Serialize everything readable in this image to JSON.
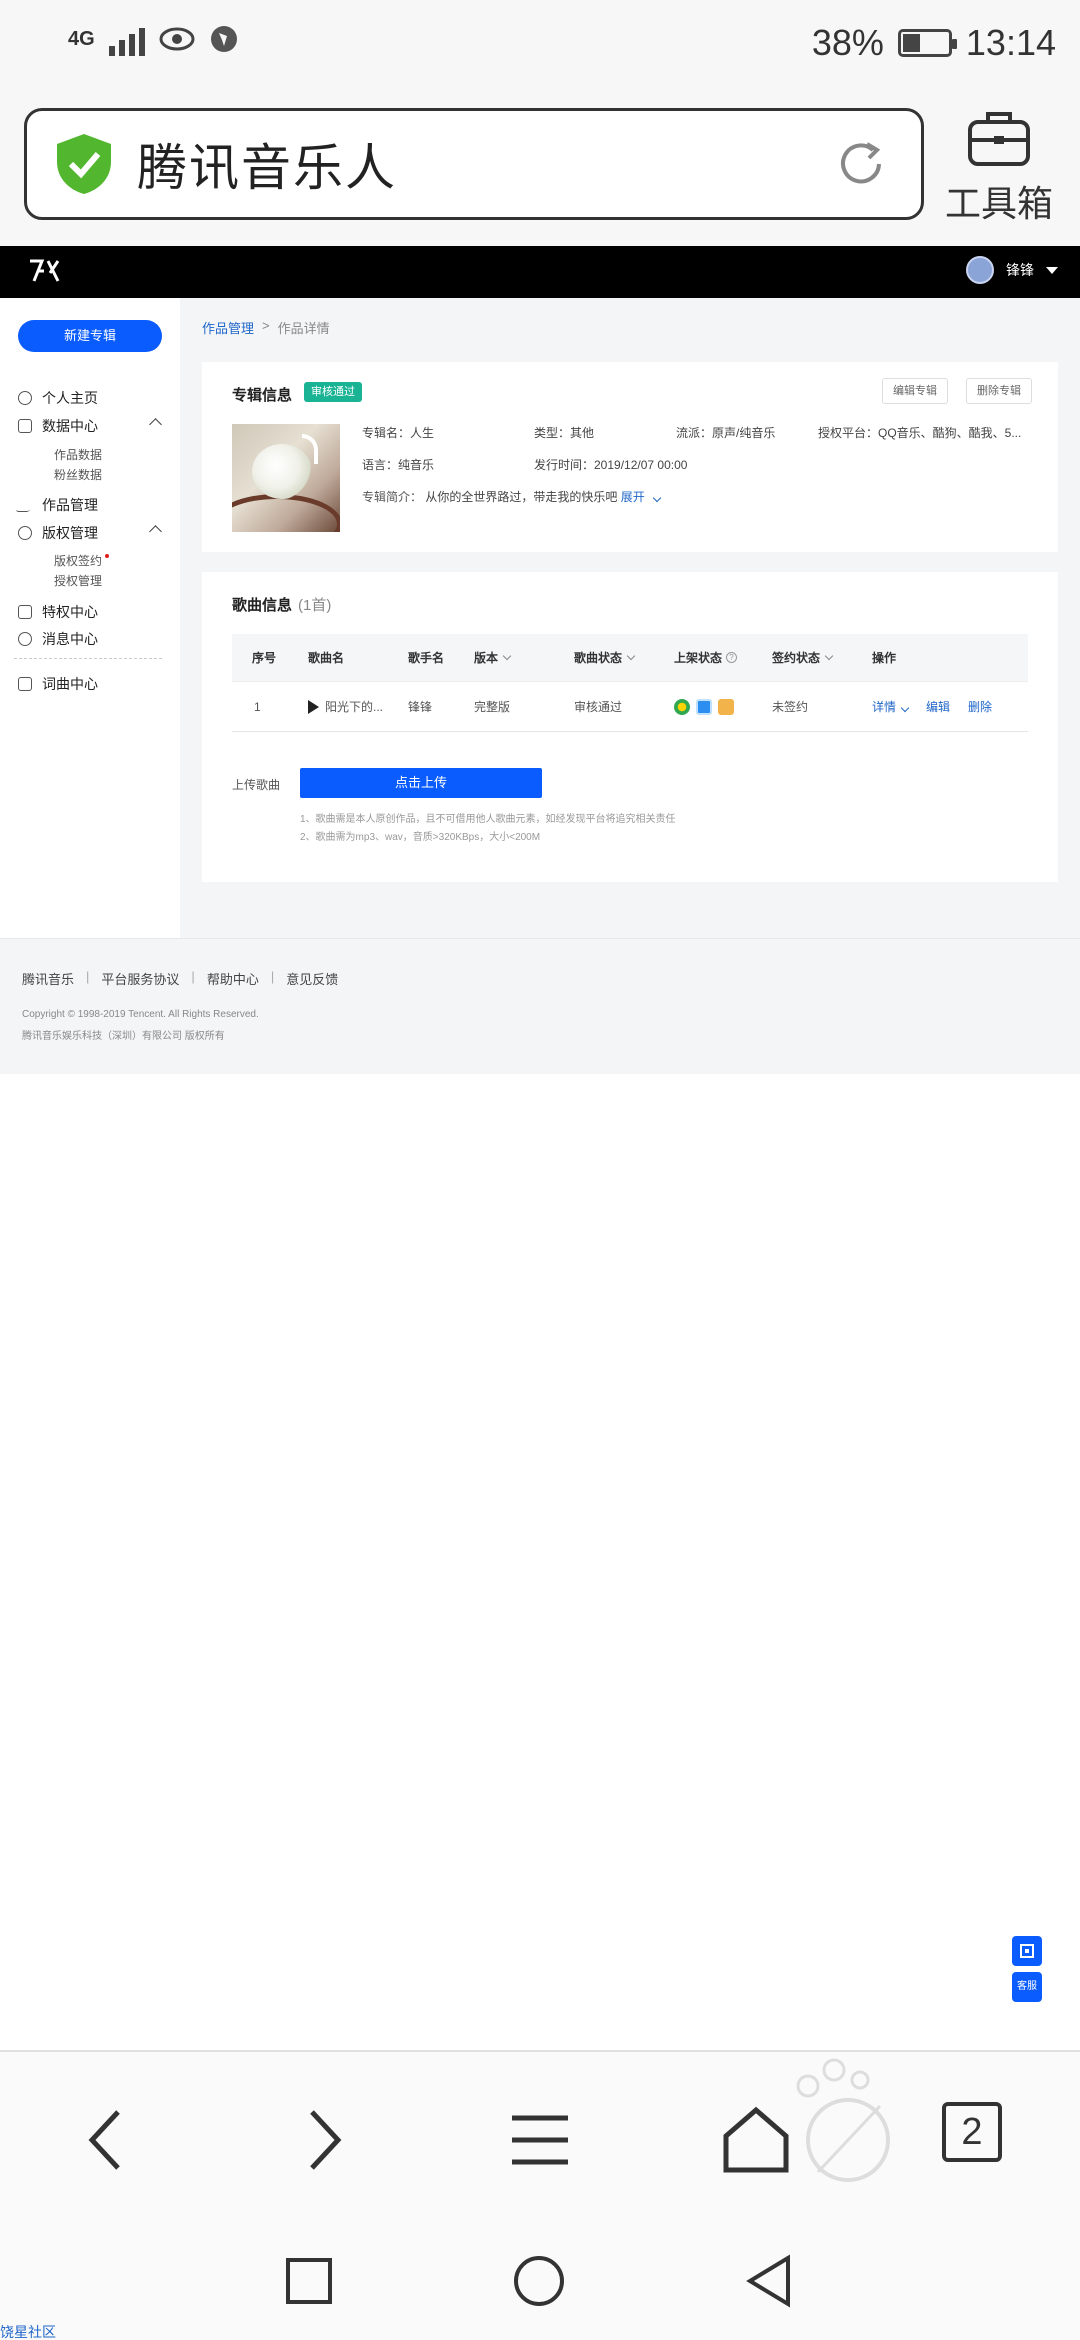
{
  "status_bar": {
    "network": "4G",
    "battery": "38%",
    "time": "13:14",
    "icons": [
      "signal-icon",
      "eye-icon",
      "location-icon",
      "battery-icon"
    ]
  },
  "browser": {
    "url_title": "腾讯音乐人",
    "toolbox_label": "工具箱",
    "tab_count": "2"
  },
  "header": {
    "logo": "ꓘ",
    "user_name": "锋锋"
  },
  "sidebar": {
    "new_album": "新建专辑",
    "items": [
      {
        "label": "个人主页"
      },
      {
        "label": "数据中心"
      },
      {
        "label": "作品管理"
      },
      {
        "label": "版权管理"
      },
      {
        "label": "特权中心"
      },
      {
        "label": "消息中心"
      },
      {
        "label": "词曲中心"
      }
    ],
    "sub_data": [
      "作品数据",
      "粉丝数据"
    ],
    "sub_copyright": [
      "版权签约",
      "授权管理"
    ]
  },
  "breadcrumb": {
    "parent": "作品管理",
    "separator": ">",
    "current": "作品详情"
  },
  "album": {
    "section_title": "专辑信息",
    "status_badge": "审核通过",
    "edit_button": "编辑专辑",
    "delete_button": "删除专辑",
    "name": "专辑名：人生",
    "type": "类型：其他",
    "genre": "流派：原声/纯音乐",
    "platforms": "授权平台：QQ音乐、酷狗、酷我、5...",
    "language": "语言：纯音乐",
    "release": "发行时间：2019/12/07 00:00",
    "intro_label": "专辑简介：",
    "intro": "从你的全世界路过，带走我的快乐吧",
    "expand": "展开"
  },
  "songs": {
    "section_title": "歌曲信息",
    "count": "(1首)",
    "columns": [
      "序号",
      "歌曲名",
      "歌手名",
      "版本",
      "歌曲状态",
      "上架状态",
      "签约状态",
      "操作"
    ],
    "rows": [
      {
        "index": "1",
        "name": "阳光下的...",
        "singer": "锋锋",
        "version": "完整版",
        "status": "审核通过",
        "sign": "未签约",
        "actions": [
          "详情",
          "编辑",
          "删除"
        ]
      }
    ],
    "upload_label": "上传歌曲",
    "upload_button": "点击上传",
    "notes": [
      "1、歌曲需是本人原创作品，且不可借用他人歌曲元素，如经发现平台将追究相关责任",
      "2、歌曲需为mp3、wav，音质>320KBps，大小<200M"
    ]
  },
  "footer": {
    "links": [
      "腾讯音乐",
      "平台服务协议",
      "帮助中心",
      "意见反馈"
    ],
    "separator": "|",
    "copyright": "Copyright © 1998-2019 Tencent. All Rights Reserved.",
    "company": "腾讯音乐娱乐科技（深圳）有限公司 版权所有"
  },
  "floating": {
    "service": "客服"
  },
  "corner_text": "饶星社区",
  "colors": {
    "primary": "#0b5cff",
    "success": "#1ab394",
    "link": "#1f66c9",
    "header_bg": "#000000"
  }
}
